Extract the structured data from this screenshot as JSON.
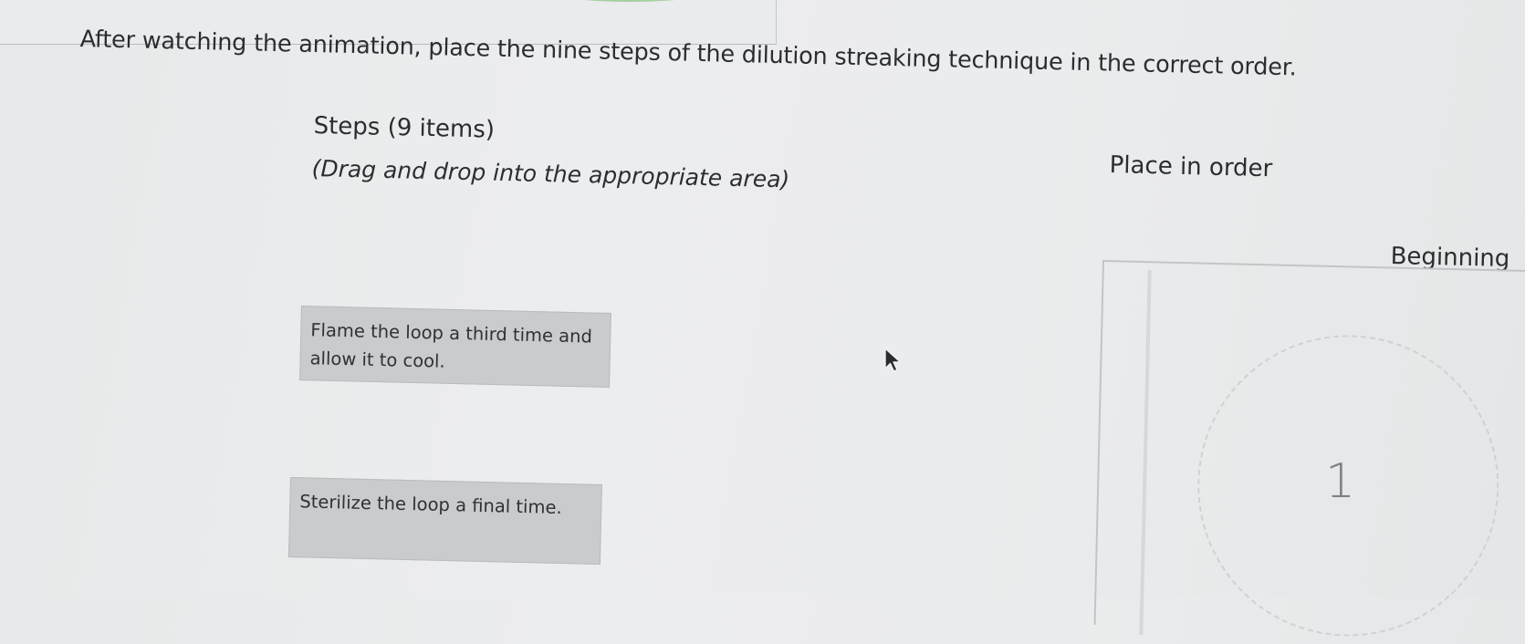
{
  "instructions": "After watching the animation, place the nine steps of the dilution streaking technique in the correct order.",
  "steps_panel": {
    "title": "Steps (9 items)",
    "hint": "(Drag and drop into the appropriate area)",
    "items": [
      {
        "label": "Flame the loop a third time and allow it to cool."
      },
      {
        "label": "Sterilize the loop a final time."
      }
    ]
  },
  "order_panel": {
    "title": "Place in order",
    "start_label": "Beginning",
    "slots": [
      {
        "number": "1"
      }
    ]
  },
  "icons": {
    "cursor": "mouse-pointer-icon"
  },
  "colors": {
    "card_background": "#c9cbcc",
    "page_background": "#ebeced",
    "accent_green": "#b7d8b4"
  }
}
